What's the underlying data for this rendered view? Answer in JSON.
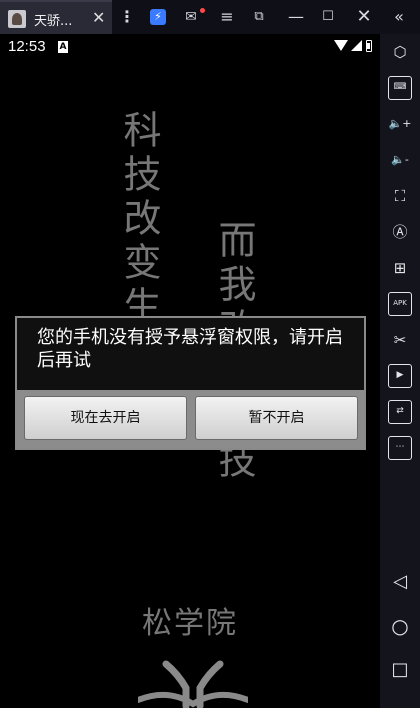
{
  "titlebar": {
    "tab_title": "天骄...",
    "close_glyph": "✕",
    "kebab_glyph": "⋮",
    "bolt_glyph": "⚡",
    "mail_glyph": "✉",
    "menu_glyph": "≡",
    "restore_glyph": "⧉",
    "minimize_glyph": "—",
    "maximize_glyph": "☐",
    "window_close_glyph": "✕",
    "collapse_glyph": "«",
    "notification_color": "#ff4a4a",
    "accent_color": "#3a7bff"
  },
  "statusbar": {
    "time": "12:53",
    "notification_badge": "A"
  },
  "splash": {
    "line1": "科技改变生活",
    "line2": "而我改变科技",
    "brand": "松学院"
  },
  "dialog": {
    "message": "您的手机没有授予悬浮窗权限，请开启后再试",
    "positive_button": "现在去开启",
    "negative_button": "暂不开启"
  },
  "sidebar": {
    "items": [
      {
        "name": "settings-icon",
        "glyph": "⬡"
      },
      {
        "name": "keyboard-icon",
        "glyph": "⌨"
      },
      {
        "name": "volume-up-icon",
        "glyph": "🔈+"
      },
      {
        "name": "volume-down-icon",
        "glyph": "🔈-"
      },
      {
        "name": "screenshot-icon",
        "glyph": "⛶"
      },
      {
        "name": "auto-rotate-icon",
        "glyph": "Ⓐ"
      },
      {
        "name": "add-window-icon",
        "glyph": "⊞"
      },
      {
        "name": "apk-install-icon",
        "glyph": "APK"
      },
      {
        "name": "scissors-icon",
        "glyph": "✂"
      },
      {
        "name": "video-record-icon",
        "glyph": "▶"
      },
      {
        "name": "sync-icon",
        "glyph": "⇄"
      },
      {
        "name": "more-icon",
        "glyph": "⋯"
      },
      {
        "name": "back-icon",
        "glyph": "◁"
      },
      {
        "name": "home-icon",
        "glyph": "○"
      },
      {
        "name": "recents-icon",
        "glyph": "□"
      }
    ]
  }
}
